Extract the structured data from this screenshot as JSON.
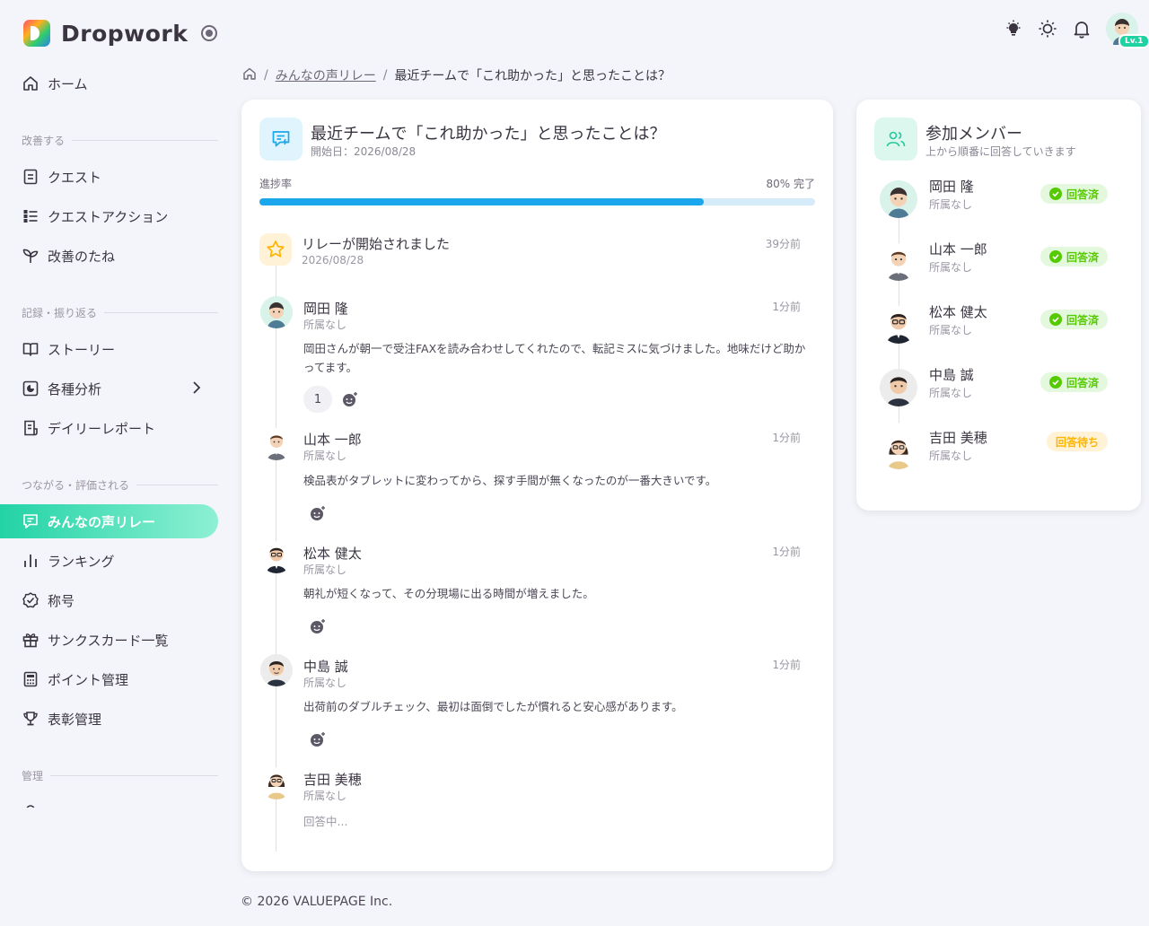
{
  "app": {
    "name": "Dropwork",
    "level_badge": "Lv.1"
  },
  "nav": {
    "home": "ホーム",
    "sections": [
      "改善する",
      "記録・振り返る",
      "つながる・評価される",
      "管理"
    ],
    "improve": [
      "クエスト",
      "クエストアクション",
      "改善のたね"
    ],
    "record": [
      "ストーリー",
      "各種分析",
      "デイリーレポート"
    ],
    "connect": [
      "みんなの声リレー",
      "ランキング",
      "称号",
      "サンクスカード一覧",
      "ポイント管理",
      "表彰管理"
    ]
  },
  "breadcrumb": {
    "link": "みんなの声リレー",
    "current": "最近チームで「これ助かった」と思ったことは？"
  },
  "relay": {
    "title": "最近チームで「これ助かった」と思ったことは？",
    "start_date": "開始日：2026/08/28",
    "progress_label": "進捗率",
    "progress_text": "80% 完了",
    "progress_value": 80,
    "start_event": {
      "text": "リレーが開始されました",
      "date": "2026/08/28",
      "time": "39分前"
    },
    "entries": [
      {
        "name": "岡田 隆",
        "affiliation": "所属なし",
        "time": "1分前",
        "text": "岡田さんが朝一で受注FAXを読み合わせしてくれたので、転記ミスに気づけました。地味だけど助かってます。",
        "reaction_count": "1"
      },
      {
        "name": "山本 一郎",
        "affiliation": "所属なし",
        "time": "1分前",
        "text": "検品表がタブレットに変わってから、探す手間が無くなったのが一番大きいです。"
      },
      {
        "name": "松本 健太",
        "affiliation": "所属なし",
        "time": "1分前",
        "text": "朝礼が短くなって、その分現場に出る時間が増えました。"
      },
      {
        "name": "中島 誠",
        "affiliation": "所属なし",
        "time": "1分前",
        "text": "出荷前のダブルチェック、最初は面倒でしたが慣れると安心感があります。"
      },
      {
        "name": "吉田 美穂",
        "affiliation": "所属なし",
        "text": "回答中..."
      }
    ]
  },
  "members": {
    "title": "参加メンバー",
    "subtitle": "上から順番に回答していきます",
    "list": [
      {
        "name": "岡田 隆",
        "affiliation": "所属なし",
        "status": "回答済"
      },
      {
        "name": "山本 一郎",
        "affiliation": "所属なし",
        "status": "回答済"
      },
      {
        "name": "松本 健太",
        "affiliation": "所属なし",
        "status": "回答済"
      },
      {
        "name": "中島 誠",
        "affiliation": "所属なし",
        "status": "回答済"
      },
      {
        "name": "吉田 美穂",
        "affiliation": "所属なし",
        "status": "回答待ち"
      }
    ]
  },
  "footer": "© 2026   VALUEPAGE Inc."
}
